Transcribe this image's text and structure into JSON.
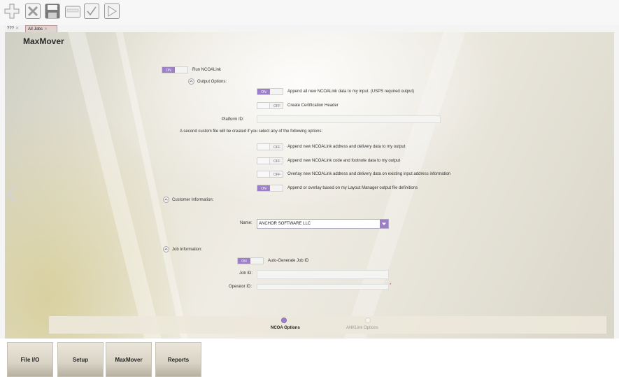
{
  "toolbar": {
    "buttons": [
      {
        "icon": "add-icon"
      },
      {
        "icon": "delete-icon"
      },
      {
        "icon": "save-icon"
      },
      {
        "icon": "folder-icon"
      },
      {
        "icon": "check-icon"
      },
      {
        "icon": "run-icon"
      }
    ]
  },
  "tabs": [
    {
      "label": "???"
    },
    {
      "label": "All Jobs"
    }
  ],
  "panel": {
    "title": "MaxMover",
    "run_ncoalink": {
      "toggle": "ON",
      "label": "Run NCOALink"
    },
    "output_options": {
      "heading": "Output Options:",
      "append_all": {
        "toggle": "ON",
        "label": "Append all new NCOALink data to my input. (USPS required output)"
      },
      "certification": {
        "toggle": "OFF",
        "label": "Create Certification Header"
      },
      "platform_label": "Platform ID:",
      "platform_value": ""
    },
    "custom_file_note": "A second custom file will be created if you select any of the following options:",
    "custom_options": [
      {
        "toggle": "OFF",
        "label": "Append new NCOALink address and delivery data to my output"
      },
      {
        "toggle": "OFF",
        "label": "Append new NCOALink code and footnote data to my output"
      },
      {
        "toggle": "OFF",
        "label": "Overlay new NCOALink address and delivery data on existing input address information"
      },
      {
        "toggle": "ON",
        "label": "Append or overlay based on my Layout Manager output file definitions"
      }
    ],
    "customer_info": {
      "heading": "Customer Information:",
      "name_label": "Name:",
      "name_value": "ANCHOR SOFTWARE LLC"
    },
    "job_info": {
      "heading": "Job Information:",
      "auto_generate": {
        "toggle": "ON",
        "label": "Auto-Generate Job ID"
      },
      "job_id_label": "Job ID:",
      "job_id_value": "",
      "operator_label": "Operator ID:",
      "operator_value": ""
    },
    "steps": [
      {
        "label": "NCOA Options",
        "active": true
      },
      {
        "label": "ANKLink Options",
        "active": false
      }
    ]
  },
  "bottom_tabs": [
    {
      "label": "File I/O"
    },
    {
      "label": "Setup"
    },
    {
      "label": "MaxMover"
    },
    {
      "label": "Reports"
    }
  ],
  "colors": {
    "accent": "#9c7fc6",
    "required": "#dd3333"
  }
}
